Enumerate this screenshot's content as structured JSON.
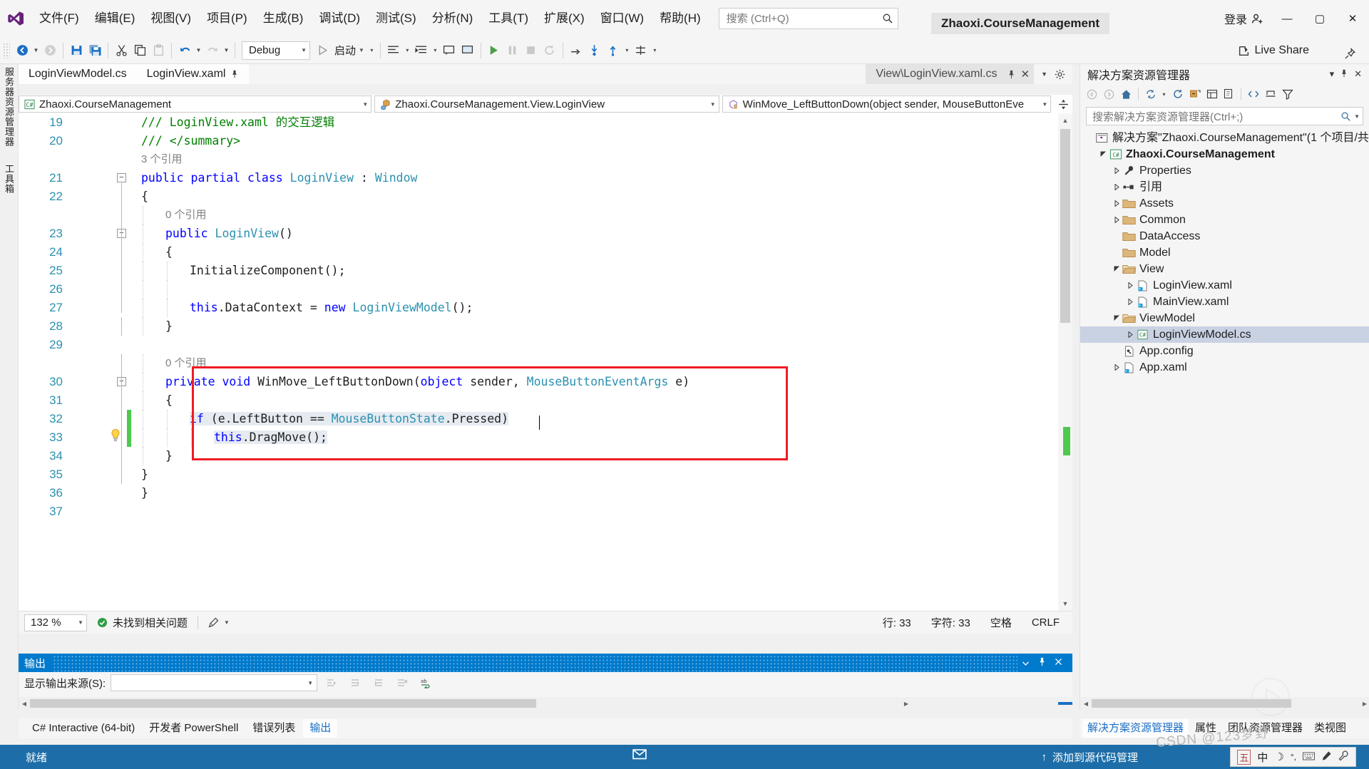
{
  "titlebar": {
    "logo_icon": "visual-studio-logo",
    "menus": [
      "文件(F)",
      "编辑(E)",
      "视图(V)",
      "项目(P)",
      "生成(B)",
      "调试(D)",
      "测试(S)",
      "分析(N)",
      "工具(T)",
      "扩展(X)",
      "窗口(W)",
      "帮助(H)"
    ],
    "search_placeholder": "搜索 (Ctrl+Q)",
    "search_icon": "magnifier-icon",
    "app_title": "Zhaoxi.CourseManagement",
    "login_label": "登录",
    "login_icon": "account-add-icon",
    "minimize": "—",
    "maximize": "▢",
    "close": "✕"
  },
  "toolbar": {
    "back_icon": "navigate-back-icon",
    "forward_icon": "navigate-forward-icon",
    "save_icon": "save-icon",
    "save_all_icon": "save-all-icon",
    "cut_icon": "cut-icon",
    "copy_icon": "copy-icon",
    "paste_icon": "paste-icon",
    "undo_icon": "undo-icon",
    "redo_icon": "redo-icon",
    "config": "Debug",
    "start_label": "启动",
    "start_icon": "play-icon",
    "live_share": "Live Share",
    "live_share_icon": "live-share-icon",
    "pin_icon": "pin-icon"
  },
  "left_strips": {
    "server_explorer": "服务器资源管理器",
    "toolbox": "工具箱"
  },
  "tabs": {
    "items": [
      {
        "label": "LoginViewModel.cs",
        "state": "normal",
        "pin": false
      },
      {
        "label": "LoginView.xaml",
        "state": "normal",
        "pin": true
      },
      {
        "label": "View\\LoginView.xaml.cs",
        "state": "selected",
        "pin": true,
        "close": "✕"
      }
    ],
    "chevron_icon": "chevron-down-icon",
    "gear_icon": "gear-icon"
  },
  "navbar": {
    "project": "Zhaoxi.CourseManagement",
    "project_icon": "csharp-project-icon",
    "type": "Zhaoxi.CourseManagement.View.LoginView",
    "type_icon": "class-icon",
    "member": "WinMove_LeftButtonDown(object sender, MouseButtonEve",
    "member_icon": "method-icon",
    "split_icon": "split-view-icon"
  },
  "code": {
    "lines": [
      {
        "n": "19",
        "indent": 0,
        "text": "/// LoginView.xaml 的交互逻辑",
        "kind": "comment"
      },
      {
        "n": "20",
        "indent": 0,
        "text": "/// </summary>",
        "kind": "comment"
      },
      {
        "n": "",
        "indent": 0,
        "text": "3 个引用",
        "kind": "codelens"
      },
      {
        "n": "21",
        "indent": 0,
        "text": "public partial class LoginView : Window",
        "kind": "decl",
        "fold": "−"
      },
      {
        "n": "22",
        "indent": 0,
        "text": "{",
        "kind": "plain"
      },
      {
        "n": "",
        "indent": 1,
        "text": "0 个引用",
        "kind": "codelens"
      },
      {
        "n": "23",
        "indent": 1,
        "text": "public LoginView()",
        "kind": "ctor",
        "fold": "−"
      },
      {
        "n": "24",
        "indent": 1,
        "text": "{",
        "kind": "plain"
      },
      {
        "n": "25",
        "indent": 2,
        "text": "InitializeComponent();",
        "kind": "plain"
      },
      {
        "n": "26",
        "indent": 2,
        "text": "",
        "kind": "plain"
      },
      {
        "n": "27",
        "indent": 2,
        "text": "this.DataContext = new LoginViewModel();",
        "kind": "assign"
      },
      {
        "n": "28",
        "indent": 1,
        "text": "}",
        "kind": "plain"
      },
      {
        "n": "29",
        "indent": 0,
        "text": "",
        "kind": "plain"
      },
      {
        "n": "",
        "indent": 1,
        "text": "0 个引用",
        "kind": "codelens"
      },
      {
        "n": "30",
        "indent": 1,
        "text": "private void WinMove_LeftButtonDown(object sender, MouseButtonEventArgs e)",
        "kind": "method",
        "fold": "−"
      },
      {
        "n": "31",
        "indent": 1,
        "text": "{",
        "kind": "plain"
      },
      {
        "n": "32",
        "indent": 2,
        "text": "if (e.LeftButton == MouseButtonState.Pressed)",
        "kind": "if"
      },
      {
        "n": "33",
        "indent": 3,
        "text": "this.DragMove();",
        "kind": "call",
        "bulb": true
      },
      {
        "n": "34",
        "indent": 1,
        "text": "}",
        "kind": "plain"
      },
      {
        "n": "35",
        "indent": 0,
        "text": "}",
        "kind": "plain"
      },
      {
        "n": "36",
        "indent": 0,
        "text": "}",
        "kind": "plain"
      },
      {
        "n": "37",
        "indent": 0,
        "text": "",
        "kind": "plain"
      }
    ],
    "highlight_color": "#e6ebf2",
    "annotation_box_color": "#ee1c25",
    "change_bar_color": "#4ec94e"
  },
  "editor_status": {
    "zoom": "132 %",
    "diagnostics": "未找到相关问题",
    "diagnostics_icon": "check-circle-icon",
    "brush_icon": "brush-icon",
    "line": "行: 33",
    "col": "字符: 33",
    "spaces": "空格",
    "eol": "CRLF"
  },
  "output": {
    "title": "输出",
    "pin_icon": "pin-icon",
    "close_icon": "close-icon",
    "minimize_icon": "chevron-down-icon",
    "source_label": "显示输出来源(S):",
    "source_value": "",
    "buttons": [
      "go-to-message-icon",
      "previous-message-icon",
      "next-message-icon",
      "clear-all-icon",
      "word-wrap-icon"
    ]
  },
  "bottom_tabs": {
    "items": [
      "C# Interactive (64-bit)",
      "开发者 PowerShell",
      "错误列表",
      "输出"
    ],
    "selected": "输出"
  },
  "solution_explorer": {
    "title": "解决方案资源管理器",
    "minimize_icon": "chevron-down-icon",
    "pin_icon": "pin-icon",
    "close_icon": "close-icon",
    "toolbar_icons": [
      "back-icon",
      "forward-icon",
      "home-icon",
      "sync-with-active-document-icon",
      "refresh-icon",
      "collapse-all-icon",
      "properties-icon",
      "show-all-files-icon",
      "code-view-icon",
      "designer-view-icon",
      "filter-icon"
    ],
    "search_placeholder": "搜索解决方案资源管理器(Ctrl+;)",
    "search_icon": "magnifier-icon",
    "tree": [
      {
        "depth": 0,
        "twisty": "",
        "icon": "solution-icon",
        "label": "解决方案\"Zhaoxi.CourseManagement\"(1 个项目/共",
        "bold": false
      },
      {
        "depth": 1,
        "twisty": "▲",
        "icon": "csharp-project-icon",
        "label": "Zhaoxi.CourseManagement",
        "bold": true
      },
      {
        "depth": 2,
        "twisty": "▶",
        "icon": "properties-wrench-icon",
        "label": "Properties",
        "bold": false
      },
      {
        "depth": 2,
        "twisty": "▶",
        "icon": "references-icon",
        "label": "引用",
        "bold": false
      },
      {
        "depth": 2,
        "twisty": "▶",
        "icon": "folder-icon",
        "label": "Assets",
        "bold": false
      },
      {
        "depth": 2,
        "twisty": "▶",
        "icon": "folder-icon",
        "label": "Common",
        "bold": false
      },
      {
        "depth": 2,
        "twisty": "",
        "icon": "folder-icon",
        "label": "DataAccess",
        "bold": false
      },
      {
        "depth": 2,
        "twisty": "",
        "icon": "folder-icon",
        "label": "Model",
        "bold": false
      },
      {
        "depth": 2,
        "twisty": "▲",
        "icon": "folder-open-icon",
        "label": "View",
        "bold": false
      },
      {
        "depth": 3,
        "twisty": "▶",
        "icon": "xaml-file-icon",
        "label": "LoginView.xaml",
        "bold": false
      },
      {
        "depth": 3,
        "twisty": "▶",
        "icon": "xaml-file-icon",
        "label": "MainView.xaml",
        "bold": false
      },
      {
        "depth": 2,
        "twisty": "▲",
        "icon": "folder-open-icon",
        "label": "ViewModel",
        "bold": false
      },
      {
        "depth": 3,
        "twisty": "▶",
        "icon": "csharp-file-icon",
        "label": "LoginViewModel.cs",
        "bold": false,
        "selected": true
      },
      {
        "depth": 2,
        "twisty": "",
        "icon": "config-file-icon",
        "label": "App.config",
        "bold": false
      },
      {
        "depth": 2,
        "twisty": "▶",
        "icon": "xaml-file-icon",
        "label": "App.xaml",
        "bold": false
      }
    ]
  },
  "right_tabs": {
    "items": [
      "解决方案资源管理器",
      "属性",
      "团队资源管理器",
      "类视图"
    ],
    "selected": "解决方案资源管理器"
  },
  "statusbar": {
    "ready": "就绪",
    "center_icon": "notifications-icon",
    "source_control": "添加到源代码管理",
    "source_control_icon": "arrow-up-icon",
    "ime": {
      "mode_box": "五",
      "lang": "中",
      "items": [
        "moon-icon",
        "punctuation-icon",
        "keyboard-icon",
        "handwriting-icon",
        "tools-icon"
      ]
    },
    "background_color": "#1d6ea8"
  },
  "watermark": "CSDN @123梦野"
}
